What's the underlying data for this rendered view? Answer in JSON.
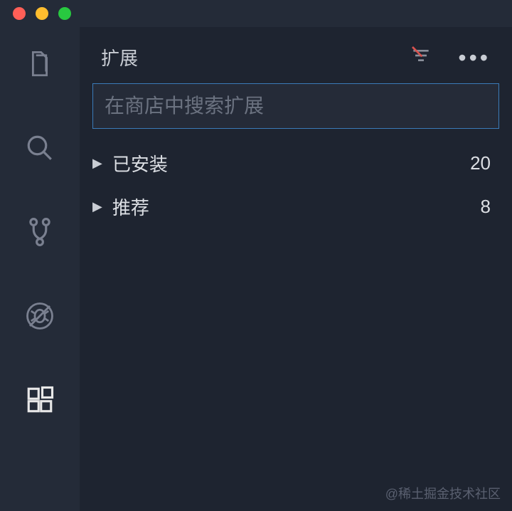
{
  "panel": {
    "title": "扩展",
    "search_placeholder": "在商店中搜索扩展"
  },
  "sections": [
    {
      "label": "已安装",
      "count": "20"
    },
    {
      "label": "推荐",
      "count": "8"
    }
  ],
  "watermark": "@稀土掘金技术社区",
  "activity_items": [
    {
      "name": "explorer",
      "active": false
    },
    {
      "name": "search",
      "active": false
    },
    {
      "name": "source-control",
      "active": false
    },
    {
      "name": "debug",
      "active": false
    },
    {
      "name": "extensions",
      "active": true
    }
  ]
}
